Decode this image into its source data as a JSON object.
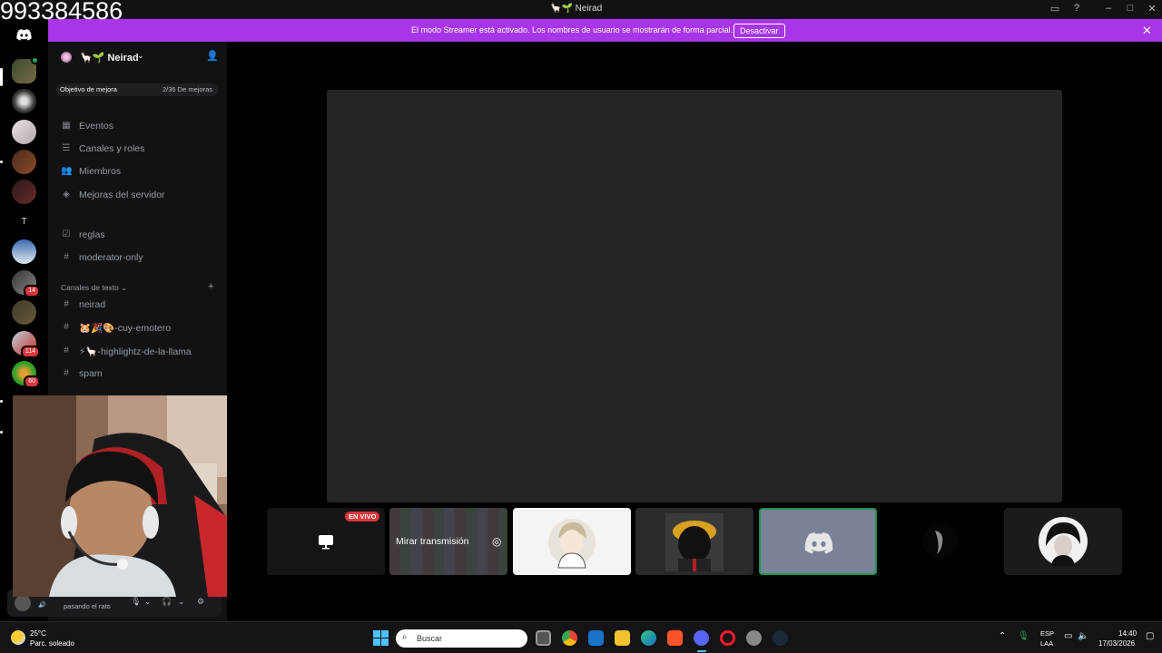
{
  "overlay": {
    "number": "993384586"
  },
  "window": {
    "title": "🦙🌱 Neirad"
  },
  "banner": {
    "text": "El modo Streamer está activado. Los nombres de usuario se mostrarán de forma parcial.",
    "button_label": "Desactivar"
  },
  "rail": {
    "letter_server": "T",
    "badges": [
      "14",
      "114",
      "60"
    ]
  },
  "server": {
    "name": "🦙🌱 Neirad",
    "boost_label": "Objetivo de mejora",
    "boost_progress": "2/36 De mejoras"
  },
  "nav": [
    {
      "label": "Eventos",
      "icon": "calendar-icon"
    },
    {
      "label": "Canales y roles",
      "icon": "channels-roles-icon"
    },
    {
      "label": "Miembros",
      "icon": "members-icon"
    },
    {
      "label": "Mejoras del servidor",
      "icon": "boost-icon"
    }
  ],
  "channels_top": [
    {
      "label": "reglas",
      "icon": "rules-icon"
    },
    {
      "label": "moderator-only",
      "icon": "hash-icon"
    }
  ],
  "category": {
    "label": "Canales de texto"
  },
  "text_channels": [
    {
      "label": "neirad"
    },
    {
      "label": "🐹🎉🎨-cuy-emotero"
    },
    {
      "label": "⚡🦙-highlightz-de-la-llama"
    },
    {
      "label": "spam"
    }
  ],
  "user": {
    "status": "pasando el rato"
  },
  "stage": {
    "live_badge": "EN VIVO",
    "watch_label": "Mirar transmisión"
  },
  "taskbar": {
    "temp": "25°C",
    "weather": "Parc. soleado",
    "search_placeholder": "Buscar",
    "lang1": "ESP",
    "lang2": "LAA",
    "time": "14:40",
    "date": "17/03/2026"
  },
  "colors": {
    "banner": "#a935e8",
    "accent": "#5865f2",
    "badge": "#da373c",
    "speaking": "#23a55a"
  }
}
